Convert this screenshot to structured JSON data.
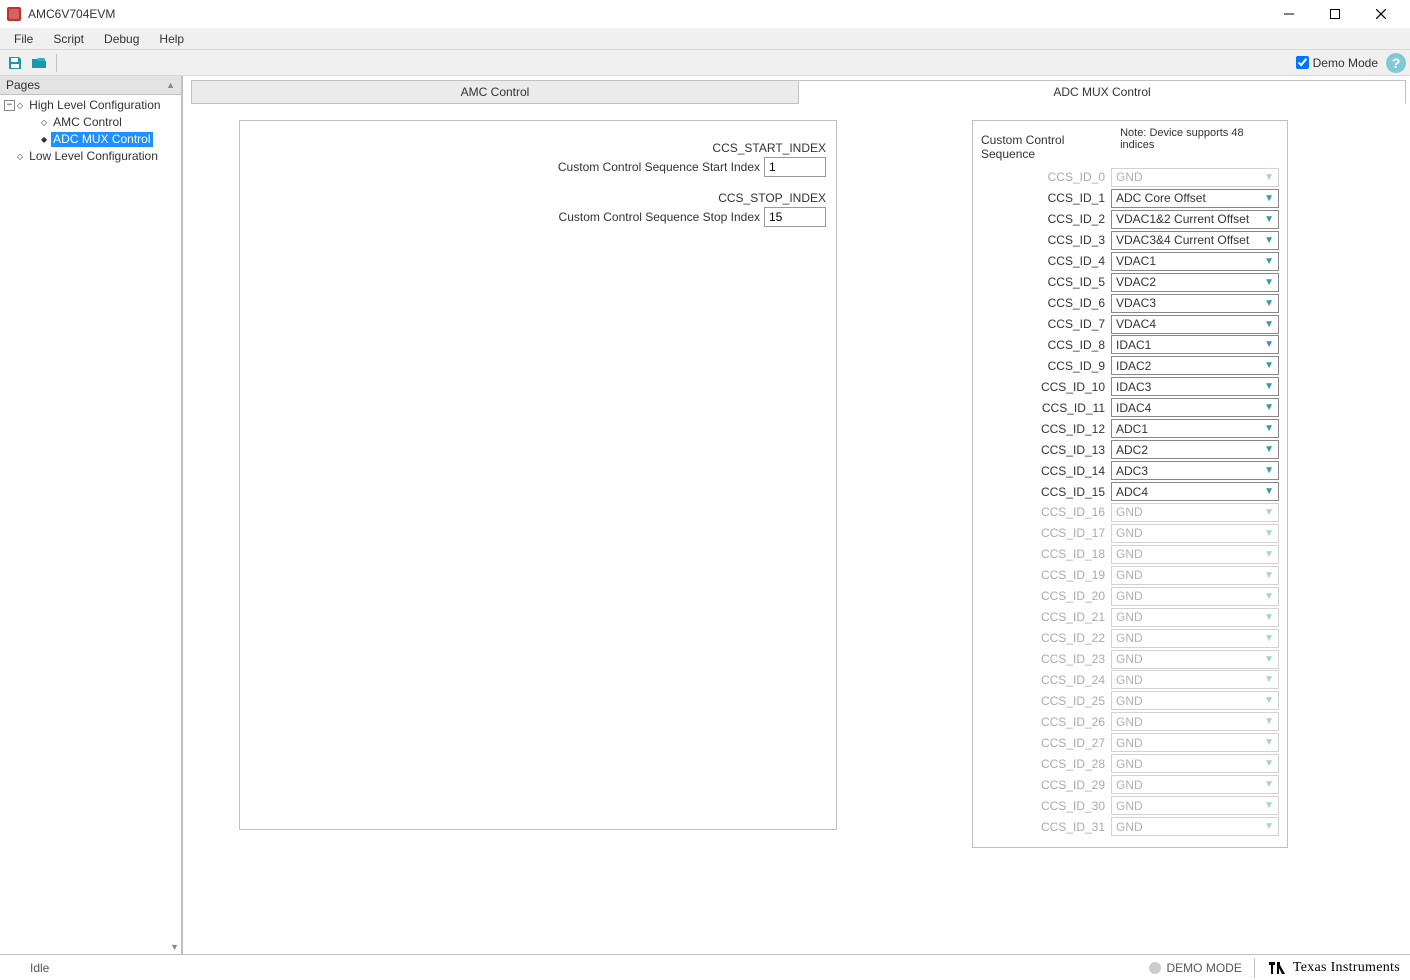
{
  "window": {
    "title": "AMC6V704EVM"
  },
  "menu": {
    "items": [
      "File",
      "Script",
      "Debug",
      "Help"
    ]
  },
  "toolbar": {
    "demo_label": "Demo Mode",
    "demo_checked": true
  },
  "sidebar": {
    "header": "Pages",
    "tree": [
      {
        "label": "High Level Configuration",
        "level": 0,
        "expander": "−",
        "bullet": "hollow",
        "selected": false
      },
      {
        "label": "AMC Control",
        "level": 1,
        "expander": "",
        "bullet": "hollow",
        "selected": false
      },
      {
        "label": "ADC MUX Control",
        "level": 1,
        "expander": "",
        "bullet": "filled",
        "selected": true
      },
      {
        "label": "Low Level Configuration",
        "level": 0,
        "expander": "",
        "bullet": "hollow",
        "selected": false
      }
    ]
  },
  "tabs": {
    "items": [
      "AMC Control",
      "ADC MUX Control"
    ],
    "active": 1
  },
  "left": {
    "start_header": "CCS_START_INDEX",
    "start_label": "Custom Control Sequence Start Index",
    "start_value": "1",
    "stop_header": "CCS_STOP_INDEX",
    "stop_label": "Custom Control Sequence Stop Index",
    "stop_value": "15"
  },
  "right": {
    "title": "Custom Control Sequence",
    "note": "Note: Device supports 48 indices",
    "rows": [
      {
        "label": "CCS_ID_0",
        "value": "GND",
        "enabled": false
      },
      {
        "label": "CCS_ID_1",
        "value": "ADC Core Offset",
        "enabled": true
      },
      {
        "label": "CCS_ID_2",
        "value": "VDAC1&2 Current Offset",
        "enabled": true
      },
      {
        "label": "CCS_ID_3",
        "value": "VDAC3&4 Current Offset",
        "enabled": true
      },
      {
        "label": "CCS_ID_4",
        "value": "VDAC1",
        "enabled": true
      },
      {
        "label": "CCS_ID_5",
        "value": "VDAC2",
        "enabled": true
      },
      {
        "label": "CCS_ID_6",
        "value": "VDAC3",
        "enabled": true
      },
      {
        "label": "CCS_ID_7",
        "value": "VDAC4",
        "enabled": true
      },
      {
        "label": "CCS_ID_8",
        "value": "IDAC1",
        "enabled": true
      },
      {
        "label": "CCS_ID_9",
        "value": "IDAC2",
        "enabled": true
      },
      {
        "label": "CCS_ID_10",
        "value": "IDAC3",
        "enabled": true
      },
      {
        "label": "CCS_ID_11",
        "value": "IDAC4",
        "enabled": true
      },
      {
        "label": "CCS_ID_12",
        "value": "ADC1",
        "enabled": true
      },
      {
        "label": "CCS_ID_13",
        "value": "ADC2",
        "enabled": true
      },
      {
        "label": "CCS_ID_14",
        "value": "ADC3",
        "enabled": true
      },
      {
        "label": "CCS_ID_15",
        "value": "ADC4",
        "enabled": true
      },
      {
        "label": "CCS_ID_16",
        "value": "GND",
        "enabled": false
      },
      {
        "label": "CCS_ID_17",
        "value": "GND",
        "enabled": false
      },
      {
        "label": "CCS_ID_18",
        "value": "GND",
        "enabled": false
      },
      {
        "label": "CCS_ID_19",
        "value": "GND",
        "enabled": false
      },
      {
        "label": "CCS_ID_20",
        "value": "GND",
        "enabled": false
      },
      {
        "label": "CCS_ID_21",
        "value": "GND",
        "enabled": false
      },
      {
        "label": "CCS_ID_22",
        "value": "GND",
        "enabled": false
      },
      {
        "label": "CCS_ID_23",
        "value": "GND",
        "enabled": false
      },
      {
        "label": "CCS_ID_24",
        "value": "GND",
        "enabled": false
      },
      {
        "label": "CCS_ID_25",
        "value": "GND",
        "enabled": false
      },
      {
        "label": "CCS_ID_26",
        "value": "GND",
        "enabled": false
      },
      {
        "label": "CCS_ID_27",
        "value": "GND",
        "enabled": false
      },
      {
        "label": "CCS_ID_28",
        "value": "GND",
        "enabled": false
      },
      {
        "label": "CCS_ID_29",
        "value": "GND",
        "enabled": false
      },
      {
        "label": "CCS_ID_30",
        "value": "GND",
        "enabled": false
      },
      {
        "label": "CCS_ID_31",
        "value": "GND",
        "enabled": false
      }
    ]
  },
  "status": {
    "idle": "Idle",
    "demo": "DEMO MODE",
    "brand": "Texas Instruments"
  }
}
